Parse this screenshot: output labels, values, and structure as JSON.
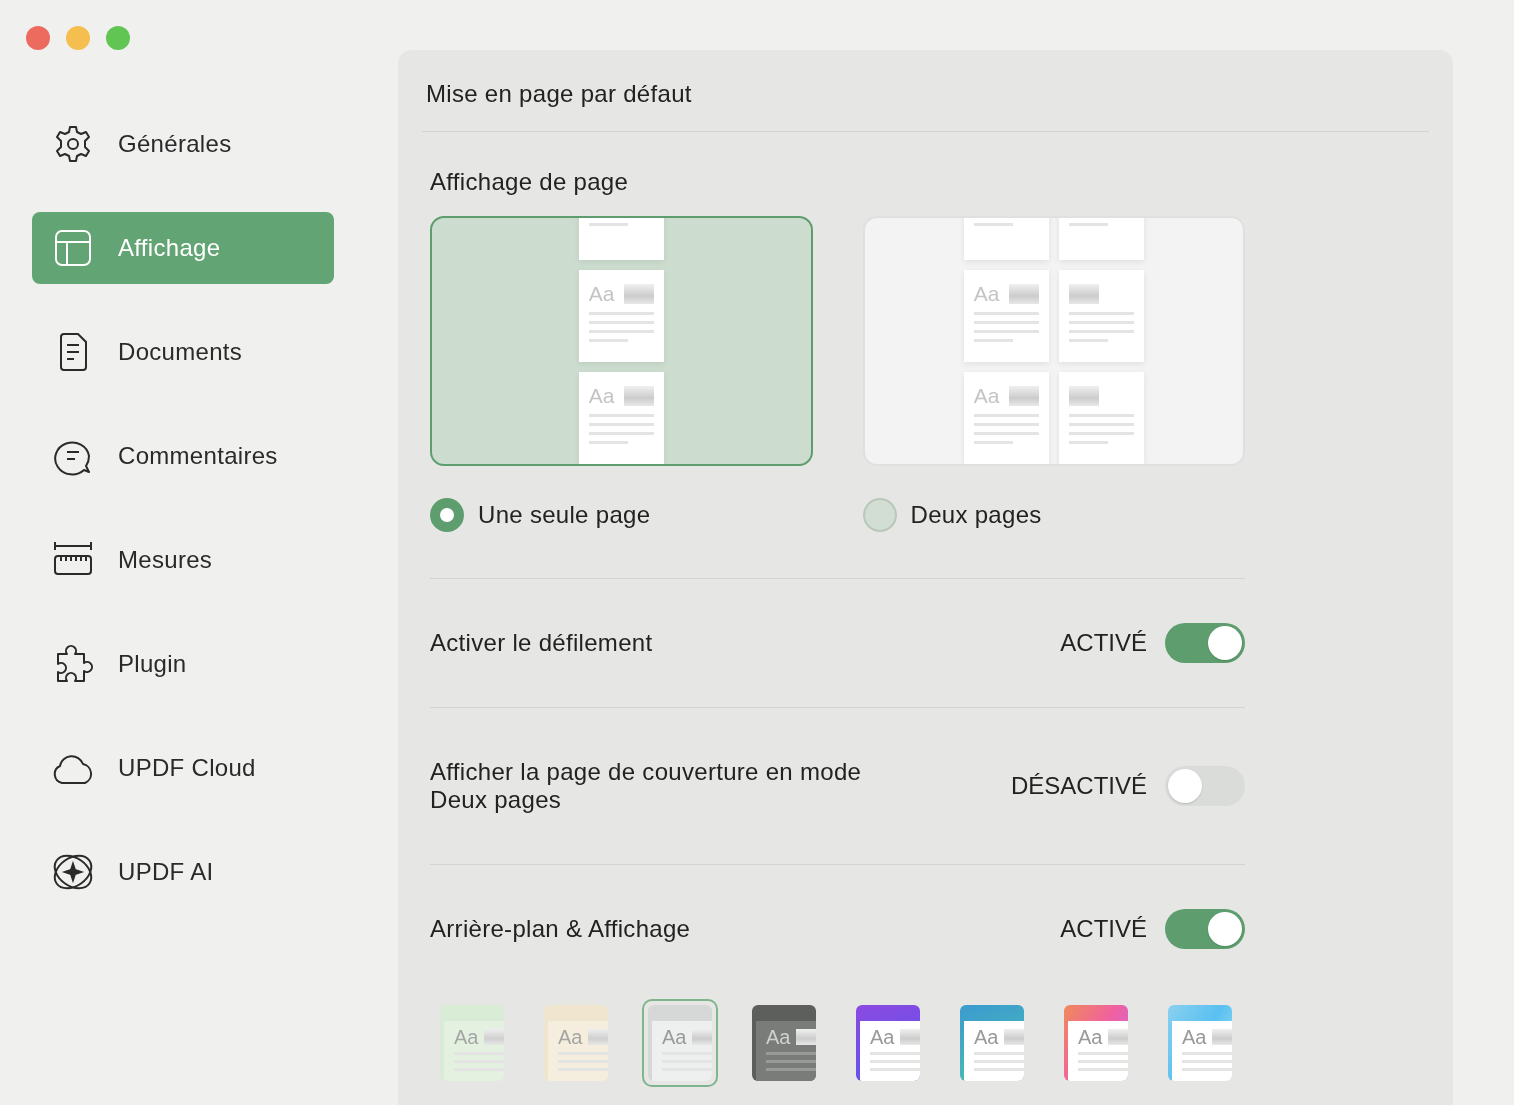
{
  "window_controls": [
    {
      "kind": "close"
    },
    {
      "kind": "minimize"
    },
    {
      "kind": "zoom"
    }
  ],
  "sidebar": {
    "items": [
      {
        "label": "Générales",
        "selected": false
      },
      {
        "label": "Affichage",
        "selected": true
      },
      {
        "label": "Documents",
        "selected": false
      },
      {
        "label": "Commentaires",
        "selected": false
      },
      {
        "label": "Mesures",
        "selected": false
      },
      {
        "label": "Plugin",
        "selected": false
      },
      {
        "label": "UPDF Cloud",
        "selected": false
      },
      {
        "label": "UPDF AI",
        "selected": false
      }
    ]
  },
  "panel": {
    "title": "Mise en page par défaut",
    "section_title": "Affichage de page",
    "layouts": [
      {
        "kind": "single",
        "label": "Une seule page",
        "selected": true,
        "page_labels": [
          "Aa",
          "Aa"
        ]
      },
      {
        "kind": "double",
        "label": "Deux pages",
        "selected": false,
        "page_labels": [
          "Aa",
          "Aa"
        ]
      }
    ],
    "settings": [
      {
        "label": "Activer le défilement",
        "status": "ACTIVÉ",
        "on": true
      },
      {
        "label": "Afficher la page de couverture en mode Deux pages",
        "status": "DÉSACTIVÉ",
        "on": false
      },
      {
        "label": "Arrière-plan & Affichage",
        "status": "ACTIVÉ",
        "on": true
      }
    ],
    "themes": [
      {
        "kind": "mint",
        "label": "Aa",
        "selected": false
      },
      {
        "kind": "cream",
        "label": "Aa",
        "selected": false
      },
      {
        "kind": "grey",
        "label": "Aa",
        "selected": true
      },
      {
        "kind": "dark",
        "label": "Aa",
        "selected": false
      },
      {
        "kind": "violet",
        "label": "Aa",
        "selected": false
      },
      {
        "kind": "teal",
        "label": "Aa",
        "selected": false
      },
      {
        "kind": "sunset",
        "label": "Aa",
        "selected": false
      },
      {
        "kind": "sky",
        "label": "Aa",
        "selected": false
      }
    ]
  }
}
